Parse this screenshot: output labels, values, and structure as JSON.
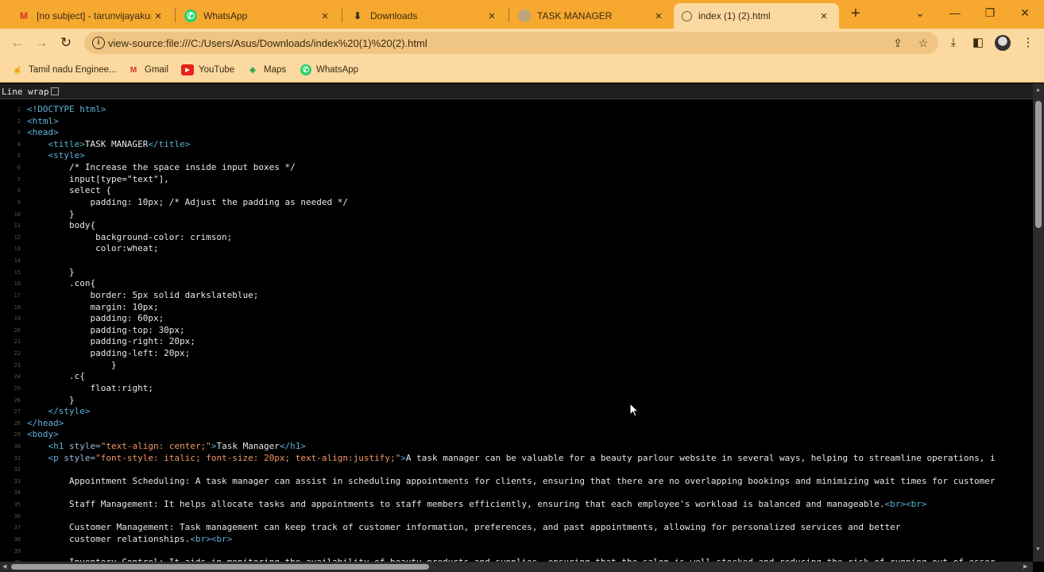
{
  "tabs": [
    {
      "title": "[no subject] - tarunvijayakum",
      "icon": "gmail-icon",
      "active": false
    },
    {
      "title": "WhatsApp",
      "icon": "whatsapp-icon",
      "active": false
    },
    {
      "title": "Downloads",
      "icon": "download-icon",
      "active": false
    },
    {
      "title": "TASK MANAGER",
      "icon": "globe-icon",
      "active": false
    },
    {
      "title": "index (1) (2).html",
      "icon": "globe-icon",
      "active": true
    }
  ],
  "toolbar": {
    "url": "view-source:file:///C:/Users/Asus/Downloads/index%20(1)%20(2).html"
  },
  "bookmarks": [
    {
      "label": "Tamil nadu Enginee...",
      "icon": "hand-icon"
    },
    {
      "label": "Gmail",
      "icon": "gmail-icon"
    },
    {
      "label": "YouTube",
      "icon": "youtube-icon"
    },
    {
      "label": "Maps",
      "icon": "maps-icon"
    },
    {
      "label": "WhatsApp",
      "icon": "whatsapp-icon"
    }
  ],
  "viewer": {
    "line_wrap_label": "Line wrap",
    "line_wrap_checked": false
  },
  "colors": {
    "tab_bar": "#f6a82f",
    "toolbar": "#fcd9a0",
    "code_bg": "#000000",
    "tag": "#5db0d7",
    "attr_value": "#f29766"
  },
  "code_lines": [
    {
      "n": "1",
      "parts": [
        [
          "tag",
          "<!DOCTYPE html>"
        ]
      ]
    },
    {
      "n": "2",
      "parts": [
        [
          "tag",
          "<html>"
        ]
      ]
    },
    {
      "n": "3",
      "parts": [
        [
          "tag",
          "<head>"
        ]
      ]
    },
    {
      "n": "4",
      "parts": [
        [
          "tx",
          "    "
        ],
        [
          "tag",
          "<title>"
        ],
        [
          "tx",
          "TASK MANAGER"
        ],
        [
          "tag",
          "</title>"
        ]
      ]
    },
    {
      "n": "5",
      "parts": [
        [
          "tx",
          "    "
        ],
        [
          "tag",
          "<style>"
        ]
      ]
    },
    {
      "n": "6",
      "parts": [
        [
          "tx",
          "        /* Increase the space inside input boxes */"
        ]
      ]
    },
    {
      "n": "7",
      "parts": [
        [
          "tx",
          "        input[type=\"text\"],"
        ]
      ]
    },
    {
      "n": "8",
      "parts": [
        [
          "tx",
          "        select {"
        ]
      ]
    },
    {
      "n": "9",
      "parts": [
        [
          "tx",
          "            padding: 10px; /* Adjust the padding as needed */"
        ]
      ]
    },
    {
      "n": "10",
      "parts": [
        [
          "tx",
          "        }"
        ]
      ]
    },
    {
      "n": "11",
      "parts": [
        [
          "tx",
          "        body{"
        ]
      ]
    },
    {
      "n": "12",
      "parts": [
        [
          "tx",
          "             background-color: crimson;"
        ]
      ]
    },
    {
      "n": "13",
      "parts": [
        [
          "tx",
          "             color:wheat;"
        ]
      ]
    },
    {
      "n": "14",
      "parts": [
        [
          "tx",
          ""
        ]
      ]
    },
    {
      "n": "15",
      "parts": [
        [
          "tx",
          "        }"
        ]
      ]
    },
    {
      "n": "16",
      "parts": [
        [
          "tx",
          "        .con{"
        ]
      ]
    },
    {
      "n": "17",
      "parts": [
        [
          "tx",
          "            border: 5px solid darkslateblue;"
        ]
      ]
    },
    {
      "n": "18",
      "parts": [
        [
          "tx",
          "            margin: 10px;"
        ]
      ]
    },
    {
      "n": "19",
      "parts": [
        [
          "tx",
          "            padding: 60px;"
        ]
      ]
    },
    {
      "n": "20",
      "parts": [
        [
          "tx",
          "            padding-top: 30px;"
        ]
      ]
    },
    {
      "n": "21",
      "parts": [
        [
          "tx",
          "            padding-right: 20px;"
        ]
      ]
    },
    {
      "n": "22",
      "parts": [
        [
          "tx",
          "            padding-left: 20px;"
        ]
      ]
    },
    {
      "n": "23",
      "parts": [
        [
          "tx",
          "                }"
        ]
      ]
    },
    {
      "n": "24",
      "parts": [
        [
          "tx",
          "        .c{"
        ]
      ]
    },
    {
      "n": "25",
      "parts": [
        [
          "tx",
          "            float:right;"
        ]
      ]
    },
    {
      "n": "26",
      "parts": [
        [
          "tx",
          "        }"
        ]
      ]
    },
    {
      "n": "27",
      "parts": [
        [
          "tx",
          "    "
        ],
        [
          "tag",
          "</style>"
        ]
      ]
    },
    {
      "n": "28",
      "parts": [
        [
          "tag",
          "</head>"
        ]
      ]
    },
    {
      "n": "29",
      "parts": [
        [
          "tag",
          "<body>"
        ]
      ]
    },
    {
      "n": "30",
      "parts": [
        [
          "tx",
          "    "
        ],
        [
          "tag",
          "<h1 "
        ],
        [
          "attr",
          "style="
        ],
        [
          "val",
          "\"text-align: center;\""
        ],
        [
          "tag",
          ">"
        ],
        [
          "tx",
          "Task Manager"
        ],
        [
          "tag",
          "</h1>"
        ]
      ]
    },
    {
      "n": "31",
      "parts": [
        [
          "tx",
          "    "
        ],
        [
          "tag",
          "<p "
        ],
        [
          "attr",
          "style="
        ],
        [
          "val",
          "\"font-style: italic; font-size: 20px; text-align:justify;\""
        ],
        [
          "tag",
          ">"
        ],
        [
          "tx",
          "A task manager can be valuable for a beauty parlour website in several ways, helping to streamline operations, i"
        ]
      ]
    },
    {
      "n": "32",
      "parts": [
        [
          "tx",
          ""
        ]
      ]
    },
    {
      "n": "33",
      "parts": [
        [
          "tx",
          "        Appointment Scheduling: A task manager can assist in scheduling appointments for clients, ensuring that there are no overlapping bookings and minimizing wait times for customer"
        ]
      ]
    },
    {
      "n": "34",
      "parts": [
        [
          "tx",
          ""
        ]
      ]
    },
    {
      "n": "35",
      "parts": [
        [
          "tx",
          "        Staff Management: It helps allocate tasks and appointments to staff members efficiently, ensuring that each employee's workload is balanced and manageable."
        ],
        [
          "tag",
          "<br><br>"
        ]
      ]
    },
    {
      "n": "36",
      "parts": [
        [
          "tx",
          ""
        ]
      ]
    },
    {
      "n": "37",
      "parts": [
        [
          "tx",
          "        Customer Management: Task management can keep track of customer information, preferences, and past appointments, allowing for personalized services and better"
        ]
      ]
    },
    {
      "n": "38",
      "parts": [
        [
          "tx",
          "        customer relationships."
        ],
        [
          "tag",
          "<br><br>"
        ]
      ]
    },
    {
      "n": "39",
      "parts": [
        [
          "tx",
          ""
        ]
      ]
    },
    {
      "n": "40",
      "parts": [
        [
          "tx",
          "        Inventory Control: It aids in monitoring the availability of beauty products and supplies, ensuring that the salon is well-stocked and reducing the risk of running out of esser"
        ]
      ]
    }
  ]
}
